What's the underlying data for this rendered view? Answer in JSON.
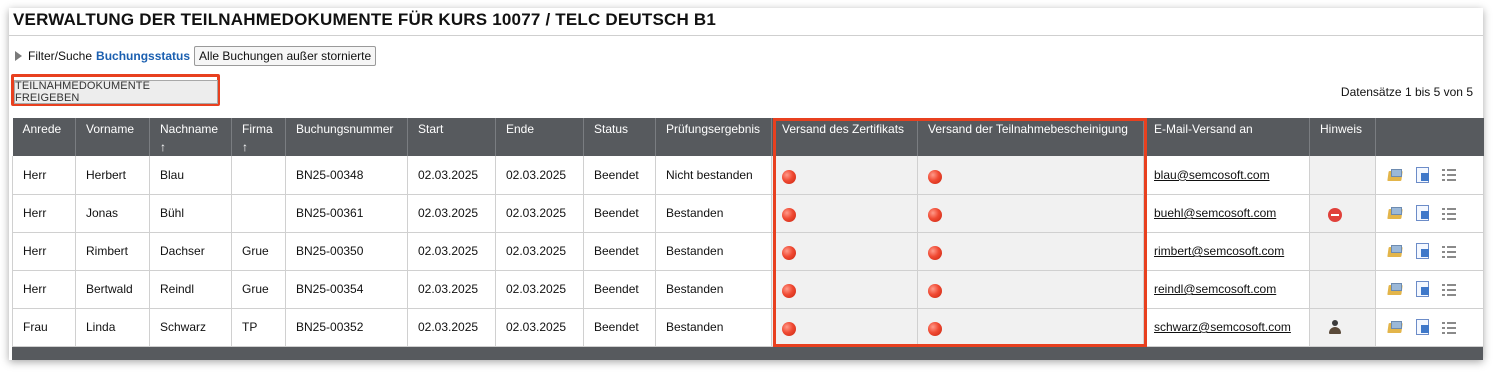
{
  "page": {
    "title": "VERWALTUNG DER TEILNAHMEDOKUMENTE FÜR KURS 10077 / TELC DEUTSCH B1"
  },
  "filter": {
    "label": "Filter/Suche",
    "key": "Buchungsstatus",
    "selected": "Alle Buchungen außer stornierte"
  },
  "toolbar": {
    "release_label": "TEILNAHMEDOKUMENTE FREIGEBEN",
    "records_info": "Datensätze 1 bis 5 von 5"
  },
  "table": {
    "columns": [
      "Anrede",
      "Vorname",
      "Nachname",
      "Firma",
      "Buchungsnummer",
      "Start",
      "Ende",
      "Status",
      "Prüfungsergebnis",
      "Versand des Zertifikats",
      "Versand der Teilnahmebescheinigung",
      "E-Mail-Versand an",
      "Hinweis",
      ""
    ],
    "sort_arrow": "↑",
    "rows": [
      {
        "anrede": "Herr",
        "vorname": "Herbert",
        "nachname": "Blau",
        "firma": "",
        "buchungsnummer": "BN25-00348",
        "start": "02.03.2025",
        "ende": "02.03.2025",
        "status": "Beendet",
        "ergebnis": "Nicht bestanden",
        "email": "blau@semcosoft.com",
        "hinweis": ""
      },
      {
        "anrede": "Herr",
        "vorname": "Jonas",
        "nachname": "Bühl",
        "firma": "",
        "buchungsnummer": "BN25-00361",
        "start": "02.03.2025",
        "ende": "02.03.2025",
        "status": "Beendet",
        "ergebnis": "Bestanden",
        "email": "buehl@semcosoft.com",
        "hinweis": "stop-icon"
      },
      {
        "anrede": "Herr",
        "vorname": "Rimbert",
        "nachname": "Dachser",
        "firma": "Grue",
        "buchungsnummer": "BN25-00350",
        "start": "02.03.2025",
        "ende": "02.03.2025",
        "status": "Beendet",
        "ergebnis": "Bestanden",
        "email": "rimbert@semcosoft.com",
        "hinweis": ""
      },
      {
        "anrede": "Herr",
        "vorname": "Bertwald",
        "nachname": "Reindl",
        "firma": "Grue",
        "buchungsnummer": "BN25-00354",
        "start": "02.03.2025",
        "ende": "02.03.2025",
        "status": "Beendet",
        "ergebnis": "Bestanden",
        "email": "reindl@semcosoft.com",
        "hinweis": ""
      },
      {
        "anrede": "Frau",
        "vorname": "Linda",
        "nachname": "Schwarz",
        "firma": "TP",
        "buchungsnummer": "BN25-00352",
        "start": "02.03.2025",
        "ende": "02.03.2025",
        "status": "Beendet",
        "ergebnis": "Bestanden",
        "email": "schwarz@semcosoft.com",
        "hinweis": "person-icon"
      }
    ]
  },
  "colors": {
    "header_bg": "#575a5e",
    "highlight": "#e8401f",
    "status_dot": "#f04a33",
    "link": "#1a5fb0"
  },
  "icons": {
    "row_actions": [
      "folder-edit-icon",
      "document-icon",
      "list-icon"
    ]
  }
}
